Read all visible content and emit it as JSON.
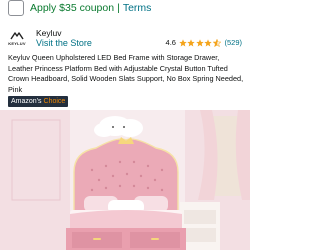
{
  "coupon": {
    "text": "Apply $35 coupon",
    "separator": "|",
    "terms_label": "Terms"
  },
  "brand": {
    "logo_text": "KEYLUV",
    "name": "Keyluv",
    "visit_store_label": "Visit the Store",
    "rating_value": "4.6",
    "rating_count": "(529)",
    "rating_stars": 4.6
  },
  "product": {
    "title": "Keyluv Queen Upholstered LED Bed Frame with Storage Drawer, Leather Princess Platform Bed with Adjustable Crystal Button Tufted Crown Headboard, Solid Wooden Slats Support, No Box Spring Needed, Pink",
    "badge_part1": "Amazon's",
    "badge_part2": "Choice"
  },
  "colors": {
    "link": "#007185",
    "coupon_green": "#0a7a2f",
    "star": "#f4a41c",
    "badge_bg": "#232f3e",
    "badge_accent": "#f08804",
    "bed_pink": "#eeb1bd"
  },
  "icons": {
    "coupon_checkbox": "checkbox-icon",
    "star": "star-icon",
    "logo": "keyluv-logo"
  }
}
